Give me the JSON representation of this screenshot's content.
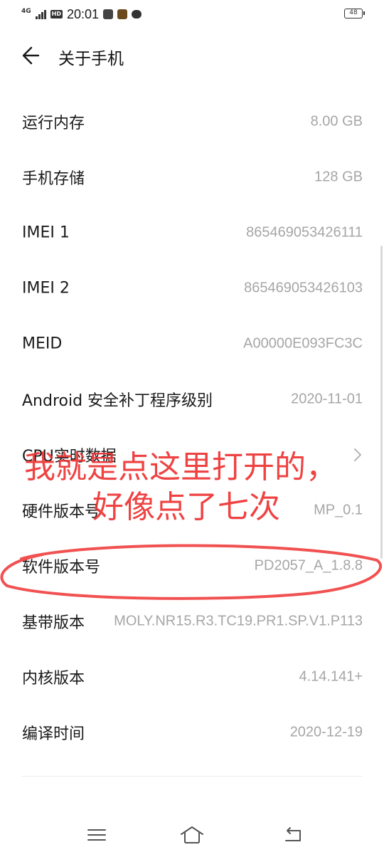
{
  "status_bar": {
    "network": "4G",
    "hd": "HD",
    "time": "20:01",
    "battery": "48"
  },
  "header": {
    "title": "关于手机"
  },
  "rows": [
    {
      "label": "运行内存",
      "value": "8.00 GB"
    },
    {
      "label": "手机存储",
      "value": "128 GB"
    },
    {
      "label": "IMEI 1",
      "value": "865469053426111"
    },
    {
      "label": "IMEI 2",
      "value": "865469053426103"
    },
    {
      "label": "MEID",
      "value": "A00000E093FC3C"
    },
    {
      "label": "Android 安全补丁程序级别",
      "value": "2020-11-01"
    },
    {
      "label": "CPU实时数据",
      "value": ""
    },
    {
      "label": "硬件版本号",
      "value": "MP_0.1"
    },
    {
      "label": "软件版本号",
      "value": "PD2057_A_1.8.8"
    },
    {
      "label": "基带版本",
      "value": "MOLY.NR15.R3.TC19.PR1.SP.V1.P113"
    },
    {
      "label": "内核版本",
      "value": "4.14.141+"
    },
    {
      "label": "编译时间",
      "value": "2020-12-19"
    }
  ],
  "annotation": {
    "line1": "我就是点这里打开的，",
    "line2": "好像点了七次",
    "color": "#ee3333"
  },
  "icons": {
    "back": "arrow-left-icon",
    "chevron": "chevron-right-icon",
    "nav_menu": "menu-icon",
    "nav_home": "home-icon",
    "nav_back": "return-icon"
  }
}
